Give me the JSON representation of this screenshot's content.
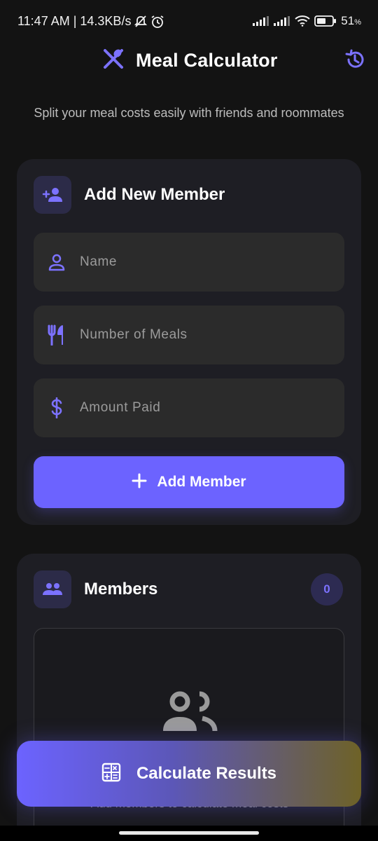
{
  "status_bar": {
    "time_speed": "11:47 AM | 14.3KB/s",
    "battery": "51",
    "battery_unit": "%",
    "icons": [
      "mute-icon",
      "alarm-icon",
      "signal-icon",
      "signal-icon",
      "wifi-icon",
      "battery-icon"
    ]
  },
  "header": {
    "title": "Meal Calculator",
    "logo_icon": "utensils-crossed-icon",
    "history_icon": "history-icon"
  },
  "subtitle": "Split your meal costs easily with friends and roommates",
  "add_member": {
    "title": "Add New Member",
    "icon": "add-person-icon",
    "fields": {
      "name_placeholder": "Name",
      "meals_placeholder": "Number of Meals",
      "amount_placeholder": "Amount Paid"
    },
    "button_label": "Add Member"
  },
  "members": {
    "title": "Members",
    "count": "0",
    "empty_text": "Add members to calculate meal costs"
  },
  "calculate_button": "Calculate Results",
  "colors": {
    "accent": "#6c63ff",
    "background": "#131313",
    "card": "#1e1e24",
    "field": "#2b2b2b"
  }
}
